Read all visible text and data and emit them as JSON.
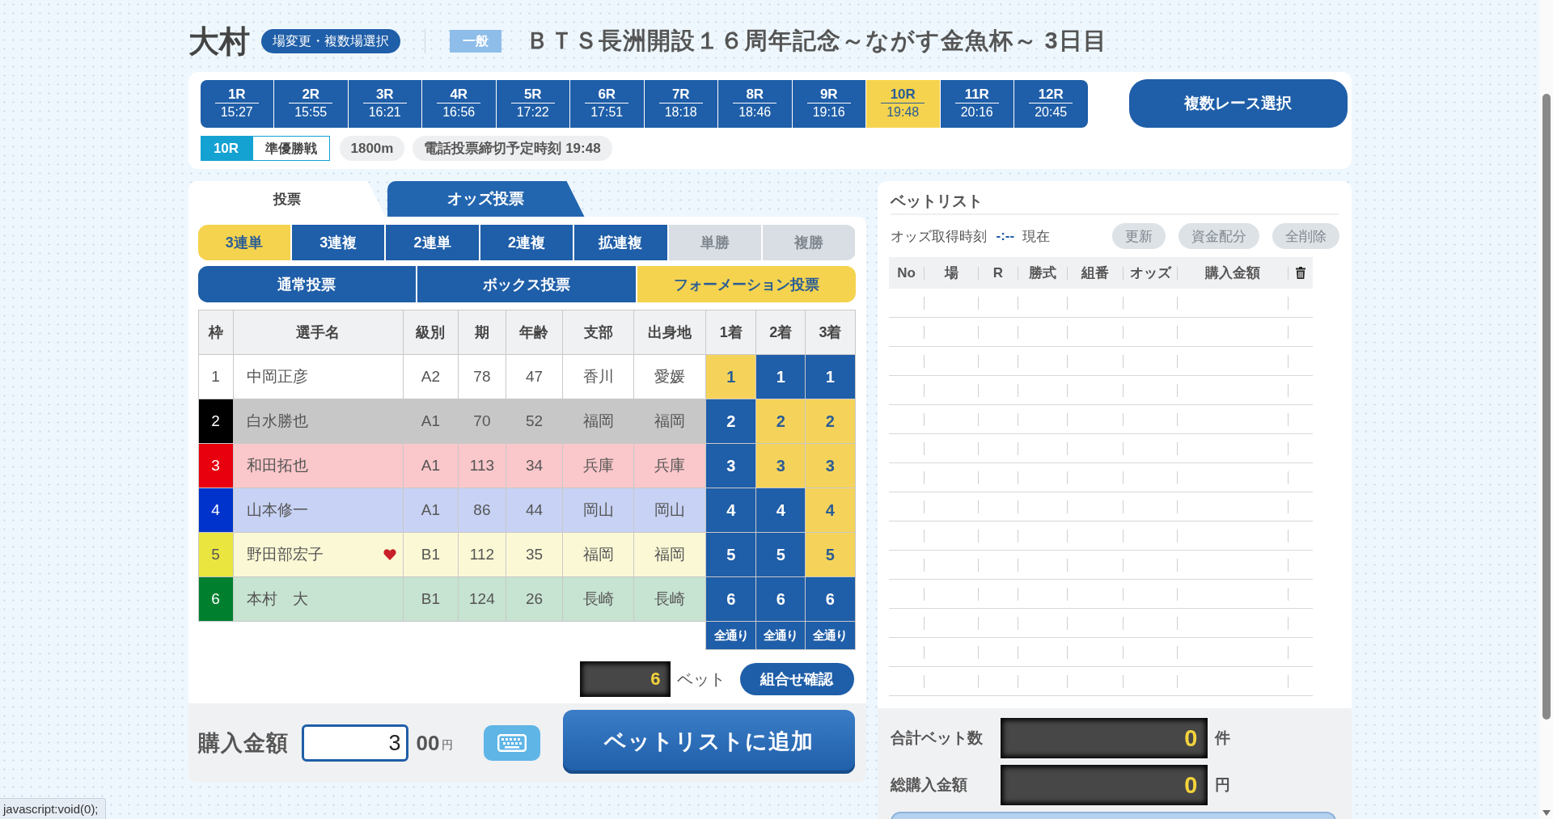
{
  "venue": {
    "name": "大村",
    "change_button": "場変更・複数場選択"
  },
  "race_meta": {
    "grade": "一般",
    "title": "ＢＴＳ長洲開設１６周年記念～ながす金魚杯～ 3日目"
  },
  "races": [
    {
      "label": "1R",
      "time": "15:27",
      "selected": false
    },
    {
      "label": "2R",
      "time": "15:55",
      "selected": false
    },
    {
      "label": "3R",
      "time": "16:21",
      "selected": false
    },
    {
      "label": "4R",
      "time": "16:56",
      "selected": false
    },
    {
      "label": "5R",
      "time": "17:22",
      "selected": false
    },
    {
      "label": "6R",
      "time": "17:51",
      "selected": false
    },
    {
      "label": "7R",
      "time": "18:18",
      "selected": false
    },
    {
      "label": "8R",
      "time": "18:46",
      "selected": false
    },
    {
      "label": "9R",
      "time": "19:16",
      "selected": false
    },
    {
      "label": "10R",
      "time": "19:48",
      "selected": true
    },
    {
      "label": "11R",
      "time": "20:16",
      "selected": false
    },
    {
      "label": "12R",
      "time": "20:45",
      "selected": false
    }
  ],
  "multi_race_button": "複数レース選択",
  "race_info": {
    "race": "10R",
    "name": "準優勝戦",
    "distance": "1800m",
    "deadline": "電話投票締切予定時刻 19:48"
  },
  "vote_tabs": [
    {
      "label": "投票",
      "selected": true
    },
    {
      "label": "オッズ投票",
      "selected": false
    }
  ],
  "bet_types": [
    {
      "label": "3連単",
      "selected": true,
      "disabled": false
    },
    {
      "label": "3連複",
      "selected": false,
      "disabled": false
    },
    {
      "label": "2連単",
      "selected": false,
      "disabled": false
    },
    {
      "label": "2連複",
      "selected": false,
      "disabled": false
    },
    {
      "label": "拡連複",
      "selected": false,
      "disabled": false
    },
    {
      "label": "単勝",
      "selected": false,
      "disabled": true
    },
    {
      "label": "複勝",
      "selected": false,
      "disabled": true
    }
  ],
  "bet_methods": [
    {
      "label": "通常投票",
      "selected": false
    },
    {
      "label": "ボックス投票",
      "selected": false
    },
    {
      "label": "フォーメーション投票",
      "selected": true
    }
  ],
  "entry_table": {
    "columns": [
      "枠",
      "選手名",
      "級別",
      "期",
      "年齢",
      "支部",
      "出身地",
      "1着",
      "2着",
      "3着"
    ],
    "rows": [
      {
        "frame": "1",
        "color": "#ffffff",
        "name": "中岡正彦",
        "favorite": false,
        "grade": "A2",
        "term": "78",
        "age": "47",
        "branch": "香川",
        "hometown": "愛媛",
        "picks": [
          {
            "label": "1",
            "selected": true
          },
          {
            "label": "1",
            "selected": false
          },
          {
            "label": "1",
            "selected": false
          }
        ]
      },
      {
        "frame": "2",
        "color": "#000000",
        "name": "白水勝也",
        "favorite": false,
        "grade": "A1",
        "term": "70",
        "age": "52",
        "branch": "福岡",
        "hometown": "福岡",
        "picks": [
          {
            "label": "2",
            "selected": false
          },
          {
            "label": "2",
            "selected": true
          },
          {
            "label": "2",
            "selected": true
          }
        ]
      },
      {
        "frame": "3",
        "color": "#e8000f",
        "name": "和田拓也",
        "favorite": false,
        "grade": "A1",
        "term": "113",
        "age": "34",
        "branch": "兵庫",
        "hometown": "兵庫",
        "picks": [
          {
            "label": "3",
            "selected": false
          },
          {
            "label": "3",
            "selected": true
          },
          {
            "label": "3",
            "selected": true
          }
        ]
      },
      {
        "frame": "4",
        "color": "#0033cc",
        "name": "山本修一",
        "favorite": false,
        "grade": "A1",
        "term": "86",
        "age": "44",
        "branch": "岡山",
        "hometown": "岡山",
        "picks": [
          {
            "label": "4",
            "selected": false
          },
          {
            "label": "4",
            "selected": false
          },
          {
            "label": "4",
            "selected": true
          }
        ]
      },
      {
        "frame": "5",
        "color": "#ebe540",
        "name": "野田部宏子",
        "favorite": true,
        "grade": "B1",
        "term": "112",
        "age": "35",
        "branch": "福岡",
        "hometown": "福岡",
        "picks": [
          {
            "label": "5",
            "selected": false
          },
          {
            "label": "5",
            "selected": false
          },
          {
            "label": "5",
            "selected": true
          }
        ]
      },
      {
        "frame": "6",
        "color": "#00802f",
        "name": "本村　大",
        "favorite": false,
        "grade": "B1",
        "term": "124",
        "age": "26",
        "branch": "長崎",
        "hometown": "長崎",
        "picks": [
          {
            "label": "6",
            "selected": false
          },
          {
            "label": "6",
            "selected": false
          },
          {
            "label": "6",
            "selected": false
          }
        ]
      }
    ],
    "all_buttons": [
      "全通り",
      "全通り",
      "全通り"
    ]
  },
  "bet_count": {
    "value": "6",
    "unit": "ベット"
  },
  "confirm_button": "組合せ確認",
  "purchase": {
    "label": "購入金額",
    "value": "3",
    "suffix": "00",
    "unit": "円"
  },
  "add_button": "ベットリストに追加",
  "bet_list": {
    "title": "ベットリスト",
    "odds_time_label": "オッズ取得時刻",
    "odds_time": "-:--",
    "odds_time_suffix": "現在",
    "buttons": [
      {
        "label": "更新",
        "disabled": true
      },
      {
        "label": "資金配分",
        "disabled": true
      },
      {
        "label": "全削除",
        "disabled": true
      }
    ],
    "columns": [
      "No",
      "場",
      "R",
      "勝式",
      "組番",
      "オッズ",
      "購入金額"
    ]
  },
  "totals": [
    {
      "label": "合計ベット数",
      "value": "0",
      "unit": "件"
    },
    {
      "label": "総購入金額",
      "value": "0",
      "unit": "円"
    }
  ],
  "status_bar": "javascript:void(0);"
}
